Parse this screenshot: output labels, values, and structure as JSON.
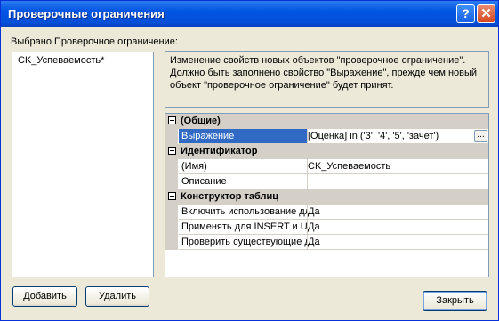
{
  "window": {
    "title": "Проверочные ограничения",
    "help_glyph": "?",
    "close_glyph": "✕"
  },
  "selected_label": "Выбрано Проверочное ограничение:",
  "constraints": [
    "CK_Успеваемость*"
  ],
  "description": "Изменение свойств новых объектов \"проверочное ограничение\". Должно быть заполнено свойство \"Выражение\", прежде чем новый объект \"проверочное ограничение\" будет принят.",
  "properties": {
    "general": {
      "label": "(Общие)",
      "expression_name": "Выражение",
      "expression_value": "[Оценка] in ('3',  '4',  '5',  'зачет')",
      "ellipsis": "..."
    },
    "identity": {
      "label": "Идентификатор",
      "name_name": "(Имя)",
      "name_value": "CK_Успеваемость",
      "description_name": "Описание",
      "description_value": ""
    },
    "designer": {
      "label": "Конструктор таблиц",
      "enable_name": "Включить использование для",
      "enable_value": "Да",
      "apply_name": "Применять для INSERT и UPDATE",
      "apply_value": "Да",
      "check_name": "Проверить существующие данные",
      "check_value": "Да"
    }
  },
  "buttons": {
    "add": "Добавить",
    "delete": "Удалить",
    "close": "Закрыть"
  }
}
